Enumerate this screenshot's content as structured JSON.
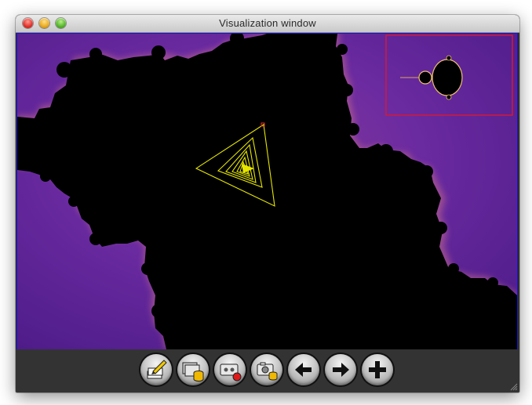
{
  "window": {
    "title": "Visualization window"
  },
  "controls": {
    "close": "close-button",
    "minimize": "minimize-button",
    "zoom": "zoom-button"
  },
  "visualization": {
    "background_color": "#4a1a78",
    "set_color": "#000000",
    "orbit_color": "#e6e600",
    "minimap_border_color": "#d01a3a",
    "viewport_border_color": "#1a14c8"
  },
  "toolbar": {
    "buttons": [
      {
        "icon": "edit-notes-icon"
      },
      {
        "icon": "layers-database-icon"
      },
      {
        "icon": "record-video-icon"
      },
      {
        "icon": "camera-database-icon"
      },
      {
        "icon": "arrow-left-icon"
      },
      {
        "icon": "arrow-right-icon"
      },
      {
        "icon": "plus-icon"
      }
    ]
  }
}
